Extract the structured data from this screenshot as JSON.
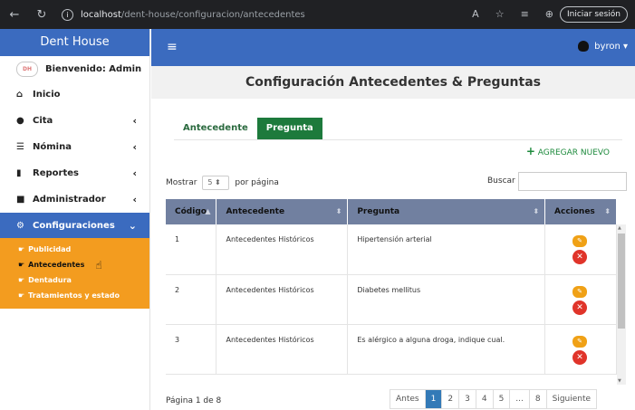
{
  "browser": {
    "url_host": "localhost",
    "url_path": "/dent-house/configuracion/antecedentes",
    "signin_label": "Iniciar sesión"
  },
  "sidebar": {
    "brand": "Dent House",
    "welcome": "Bienvenido: Admin",
    "items": [
      {
        "label": "Inicio",
        "icon": "home-icon"
      },
      {
        "label": "Cita",
        "icon": "clock-icon"
      },
      {
        "label": "Nómina",
        "icon": "list-icon"
      },
      {
        "label": "Reportes",
        "icon": "file-icon"
      },
      {
        "label": "Administrador",
        "icon": "lock-icon"
      },
      {
        "label": "Configuraciones",
        "icon": "cogs-icon"
      }
    ],
    "submenu": [
      {
        "label": "Publicidad"
      },
      {
        "label": "Antecedentes"
      },
      {
        "label": "Dentadura"
      },
      {
        "label": "Tratamientos y estado"
      }
    ]
  },
  "topbar": {
    "user": "byron"
  },
  "main": {
    "title": "Configuración Antecedentes & Preguntas",
    "tabs": [
      {
        "label": "Antecedente"
      },
      {
        "label": "Pregunta"
      }
    ],
    "add_new": "AGREGAR NUEVO",
    "show_label": "Mostrar",
    "page_size": "5",
    "per_page_label": "por página",
    "search_label": "Buscar",
    "table": {
      "headers": [
        "Código",
        "Antecedente",
        "Pregunta",
        "Acciones"
      ],
      "rows": [
        {
          "code": "1",
          "antecedente": "Antecedentes Históricos",
          "pregunta": "Hipertensión arterial"
        },
        {
          "code": "2",
          "antecedente": "Antecedentes Históricos",
          "pregunta": "Diabetes mellitus"
        },
        {
          "code": "3",
          "antecedente": "Antecedentes Históricos",
          "pregunta": "Es alérgico a alguna droga, indique cual."
        }
      ]
    },
    "page_info": "Página 1 de 8",
    "pagination": [
      "Antes",
      "1",
      "2",
      "3",
      "4",
      "5",
      "...",
      "8",
      "Siguiente"
    ]
  },
  "colors": {
    "primary_blue": "#3b6bbf",
    "orange": "#f39c1f",
    "green": "#1d7a3c",
    "header_gray": "#7180a0"
  }
}
